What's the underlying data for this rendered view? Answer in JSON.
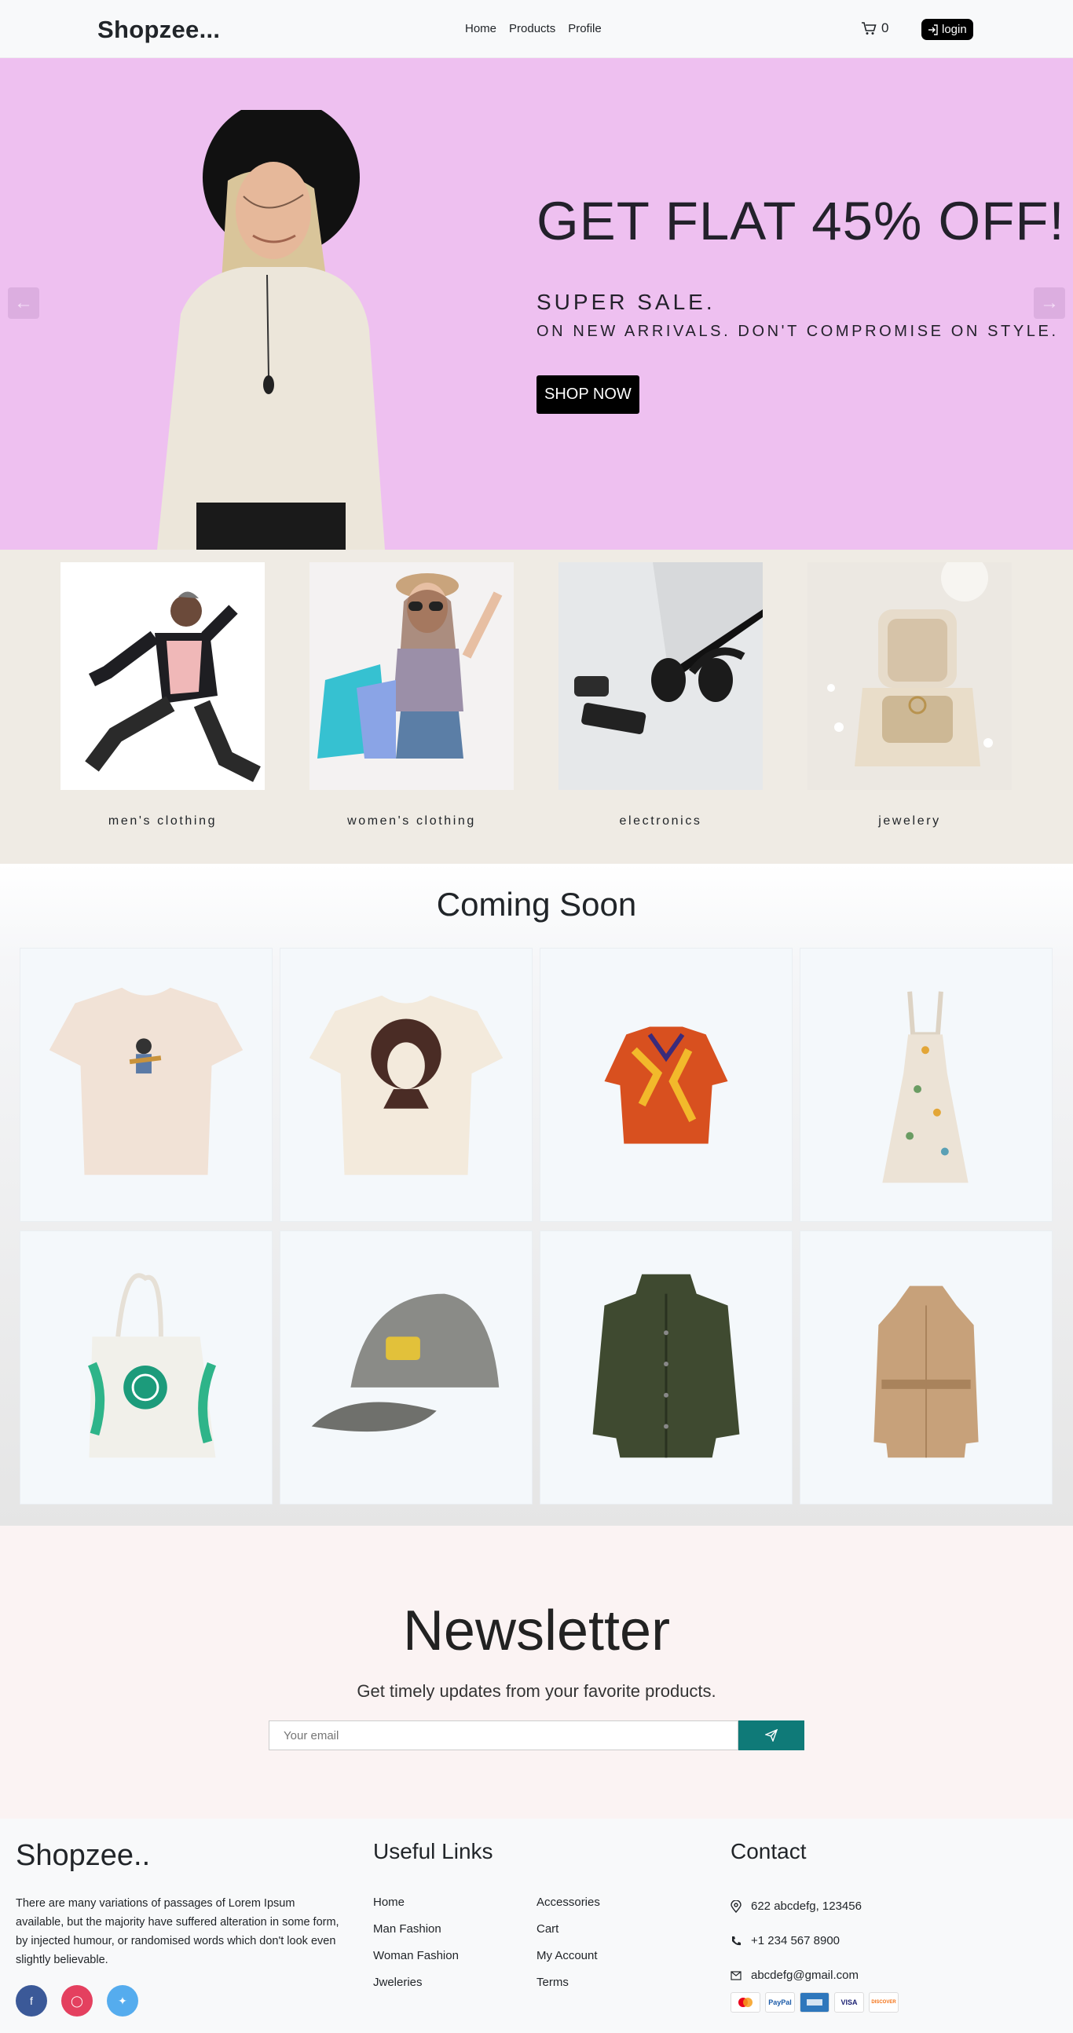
{
  "nav": {
    "brand": "Shopzee...",
    "links": [
      "Home",
      "Products",
      "Profile"
    ],
    "cart_count": "0",
    "login_label": "login"
  },
  "hero": {
    "title": "GET FLAT 45% OFF!",
    "subtitle1": "SUPER SALE.",
    "subtitle2": "ON NEW ARRIVALS. DON'T COMPROMISE ON STYLE.",
    "cta": "SHOP NOW"
  },
  "categories": [
    {
      "label": "men's clothing"
    },
    {
      "label": "women's clothing"
    },
    {
      "label": "electronics"
    },
    {
      "label": "jewelery"
    }
  ],
  "coming_soon": {
    "title": "Coming Soon",
    "items": [
      "tshirt-guitar",
      "tshirt-portrait",
      "hawaiian-shirt",
      "floral-dress",
      "tote-bag",
      "cap",
      "green-jacket",
      "trench-coat"
    ]
  },
  "newsletter": {
    "title": "Newsletter",
    "subtitle": "Get timely updates from your favorite products.",
    "placeholder": "Your email"
  },
  "footer": {
    "brand": "Shopzee..",
    "description": "There are many variations of passages of Lorem Ipsum available, but the majority have suffered alteration in some form, by injected humour, or randomised words which don't look even slightly believable.",
    "useful_links_title": "Useful Links",
    "links_col1": [
      "Home",
      "Man Fashion",
      "Woman Fashion",
      "Jweleries"
    ],
    "links_col2": [
      "Accessories",
      "Cart",
      "My Account",
      "Terms"
    ],
    "contact_title": "Contact",
    "address": "622 abcdefg, 123456",
    "phone": "+1 234 567 8900",
    "email": "abcdefg@gmail.com",
    "payment_labels": [
      "PayPal",
      "VISA",
      "DISCOVER"
    ]
  },
  "colors": {
    "hero_bg": "#eec0f0",
    "category_bg": "#efebe4",
    "accent": "#0f7a78",
    "facebook": "#3b5998",
    "instagram": "#e4405f",
    "twitter": "#55acee"
  }
}
